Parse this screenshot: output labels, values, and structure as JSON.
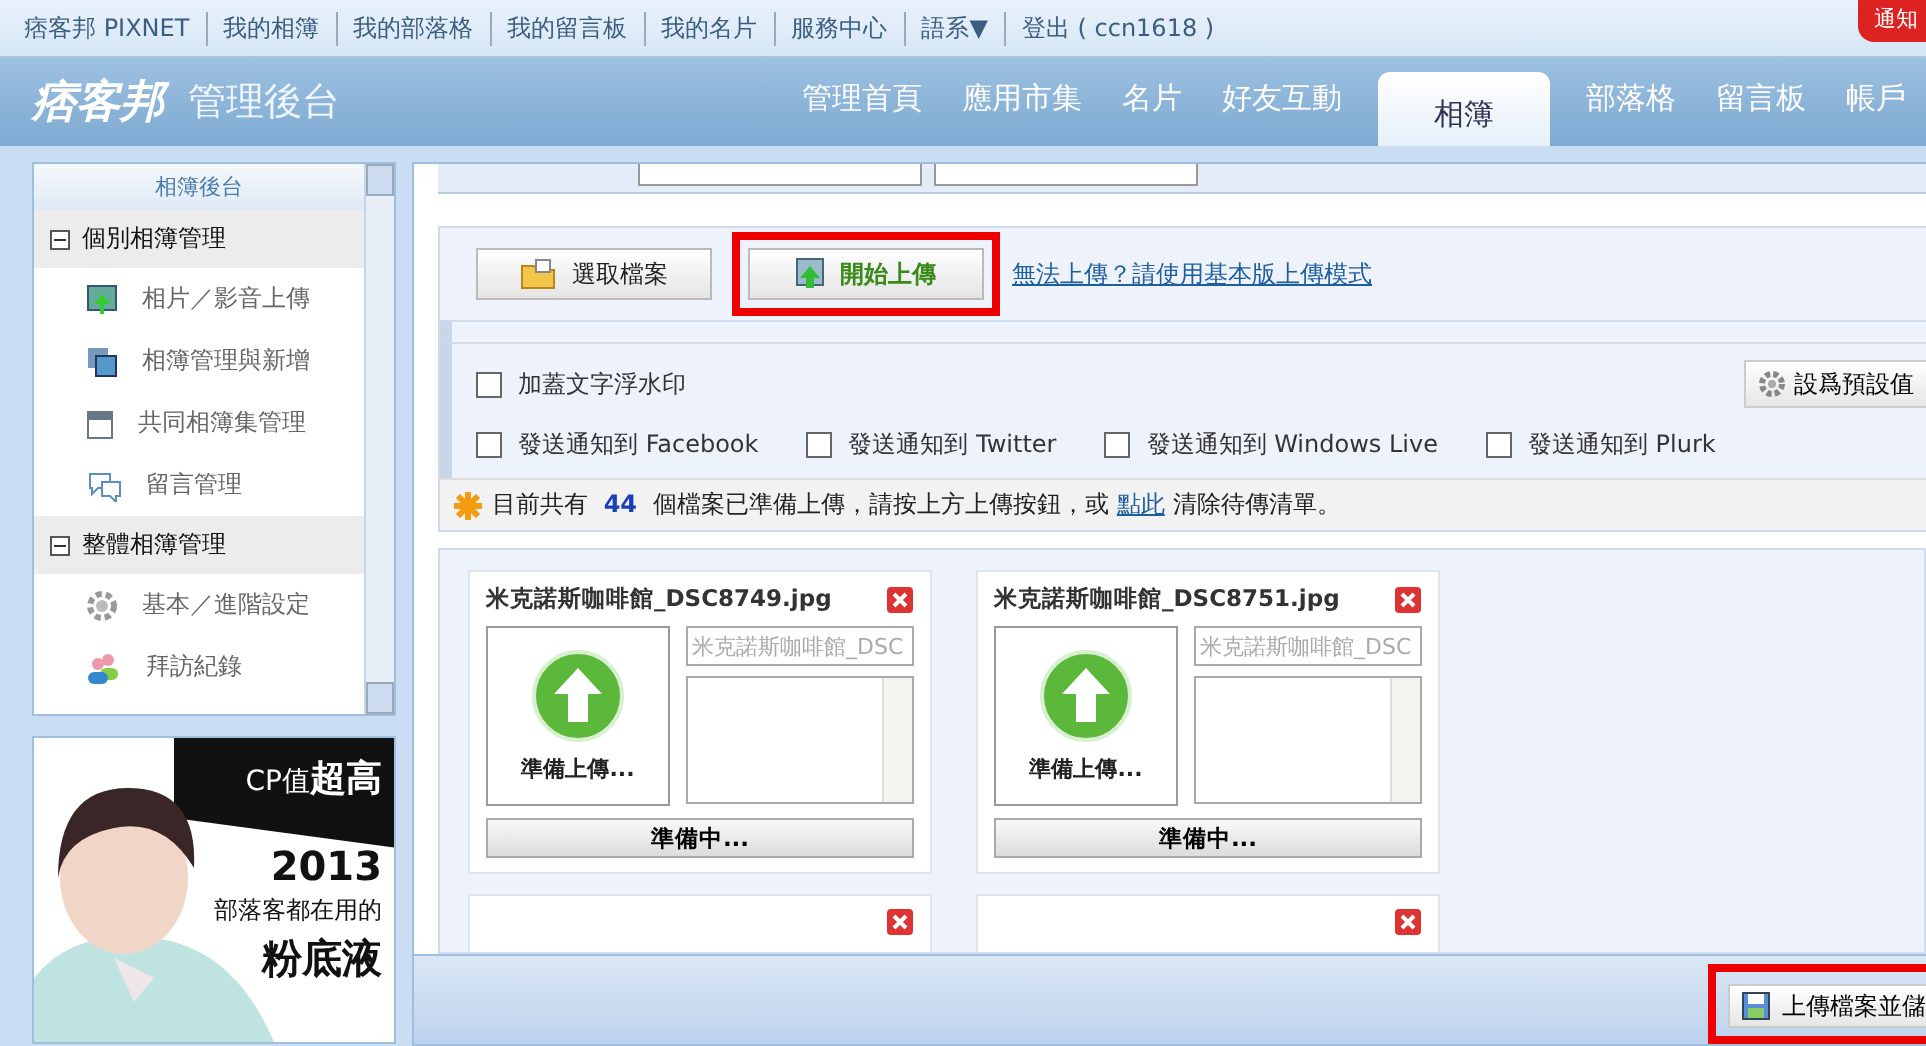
{
  "top_links": [
    {
      "label": "痞客邦 PIXNET",
      "kind": "brand"
    },
    {
      "label": "我的相簿",
      "kind": "link"
    },
    {
      "label": "我的部落格",
      "kind": "link"
    },
    {
      "label": "我的留言板",
      "kind": "link"
    },
    {
      "label": "我的名片",
      "kind": "link"
    },
    {
      "label": "服務中心",
      "kind": "link"
    },
    {
      "label": "語系▼",
      "kind": "link"
    },
    {
      "label": "登出 ( ccn1618 )",
      "kind": "link"
    }
  ],
  "notice_badge": "通知",
  "header": {
    "logo": "痞客邦",
    "title": "管理後台"
  },
  "nav": [
    {
      "label": "管理首頁",
      "selected": false
    },
    {
      "label": "應用市集",
      "selected": false
    },
    {
      "label": "名片",
      "selected": false
    },
    {
      "label": "好友互動",
      "selected": false
    },
    {
      "label": "相簿",
      "selected": true
    },
    {
      "label": "部落格",
      "selected": false
    },
    {
      "label": "留言板",
      "selected": false
    },
    {
      "label": "帳戶",
      "selected": false
    }
  ],
  "sidebar": {
    "title": "相簿後台",
    "groups": [
      {
        "label": "個別相簿管理",
        "expanded": true,
        "items": [
          {
            "label": "相片／影音上傳"
          },
          {
            "label": "相簿管理與新增"
          },
          {
            "label": "共同相簿集管理"
          },
          {
            "label": "留言管理"
          }
        ]
      },
      {
        "label": "整體相簿管理",
        "expanded": true,
        "items": [
          {
            "label": "基本／進階設定"
          },
          {
            "label": "拜訪紀錄"
          }
        ]
      }
    ]
  },
  "ad": {
    "line_1": "CP值",
    "line_1_bold": "超高",
    "line_2": "2013",
    "line_3": "部落客都在用的",
    "line_4": "粉底液"
  },
  "upload": {
    "buttons": [
      {
        "label": "選取檔案",
        "kind": "select",
        "highlighted": false
      },
      {
        "label": "開始上傳",
        "kind": "start",
        "highlighted": true
      }
    ],
    "fallback_link": "無法上傳？請使用基本版上傳模式",
    "watermark_option": {
      "label": "加蓋文字浮水印",
      "checked": false
    },
    "notify_options": [
      {
        "label": "發送通知到 Facebook",
        "checked": false
      },
      {
        "label": "發送通知到 Twitter",
        "checked": false
      },
      {
        "label": "發送通知到 Windows Live",
        "checked": false
      },
      {
        "label": "發送通知到 Plurk",
        "checked": false
      }
    ],
    "default_button": "設爲預設值",
    "status": "目前共有 **44** 個檔案已準備上傳，請按上方上傳按鈕，或",
    "status_link": "點此",
    "status_end": "清除待傳清單。"
  },
  "files": [
    {
      "name": "米克諾斯咖啡館_DSC8749.jpg",
      "title_placeholder": "米克諾斯咖啡館_DSC",
      "state": "準備上傳...",
      "progress": "準備中...",
      "level": 0
    },
    {
      "name": "米克諾斯咖啡館_DSC8751.jpg",
      "title_placeholder": "米克諾斯咖啡館_DSC",
      "state": "準備上傳...",
      "progress": "準備中...",
      "level": 0
    }
  ],
  "save_button": {
    "label": "上傳檔案並儲",
    "highlighted": true
  }
}
